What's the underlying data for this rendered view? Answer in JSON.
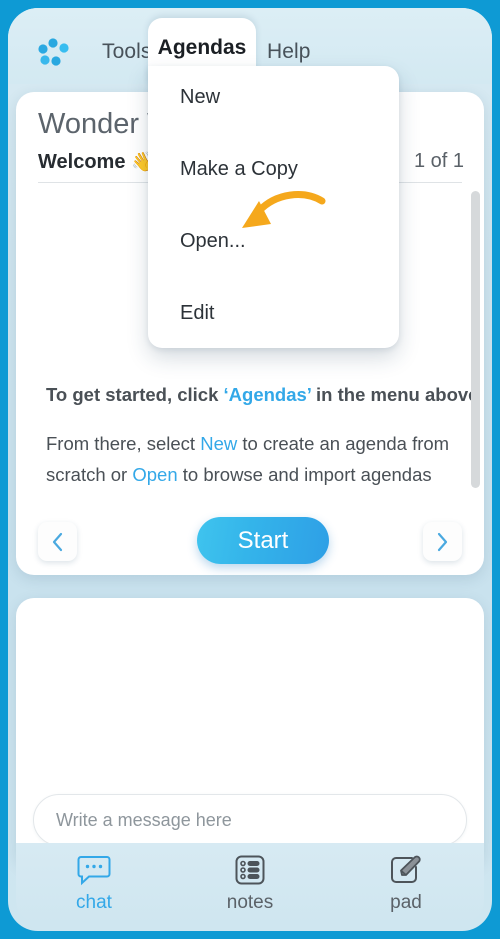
{
  "theme": {
    "backdrop_blue": "#0e9ad4",
    "panel_blue": "#d3e9f2",
    "accent": "#33a8e8",
    "arrow_orange": "#f5a81c",
    "start_gradient_from": "#3fc4ee",
    "start_gradient_to": "#2e9fe6"
  },
  "menubar": {
    "logo_icon": "dots-spinner-logo",
    "items": [
      {
        "label": "Tools",
        "active": false
      },
      {
        "label": "Agendas",
        "active": true
      },
      {
        "label": "Help",
        "active": false
      }
    ]
  },
  "dropdown": {
    "owner": "Agendas",
    "items": [
      {
        "label": "New"
      },
      {
        "label": "Make a Copy"
      },
      {
        "label": "Open..."
      },
      {
        "label": "Edit"
      }
    ],
    "pointer_arrow_target": "Open..."
  },
  "slide_card": {
    "title": "Wonder W",
    "slide_name": "Welcome",
    "slide_emoji": "👋",
    "counter": "1 of 1",
    "instructions": {
      "line1_prefix": "To get started, click ",
      "line1_link": "‘Agendas’",
      "line1_suffix": " in the menu above",
      "line2_prefix": "From there, select ",
      "line2_link1": "New",
      "line2_mid": " to create an agenda from scratch or ",
      "line2_link2": "Open",
      "line2_suffix": " to browse and import agendas"
    },
    "prev_label": "Previous slide",
    "prev_icon": "chevron-left-icon",
    "next_label": "Next slide",
    "next_icon": "chevron-right-icon",
    "start_label": "Start"
  },
  "chat_panel": {
    "input_value": "",
    "input_placeholder": "Write a message here"
  },
  "tabbar": {
    "tabs": [
      {
        "label": "chat",
        "icon": "chat-bubble-icon",
        "active": true
      },
      {
        "label": "notes",
        "icon": "list-notes-icon",
        "active": false
      },
      {
        "label": "pad",
        "icon": "pencil-pad-icon",
        "active": false
      }
    ]
  }
}
